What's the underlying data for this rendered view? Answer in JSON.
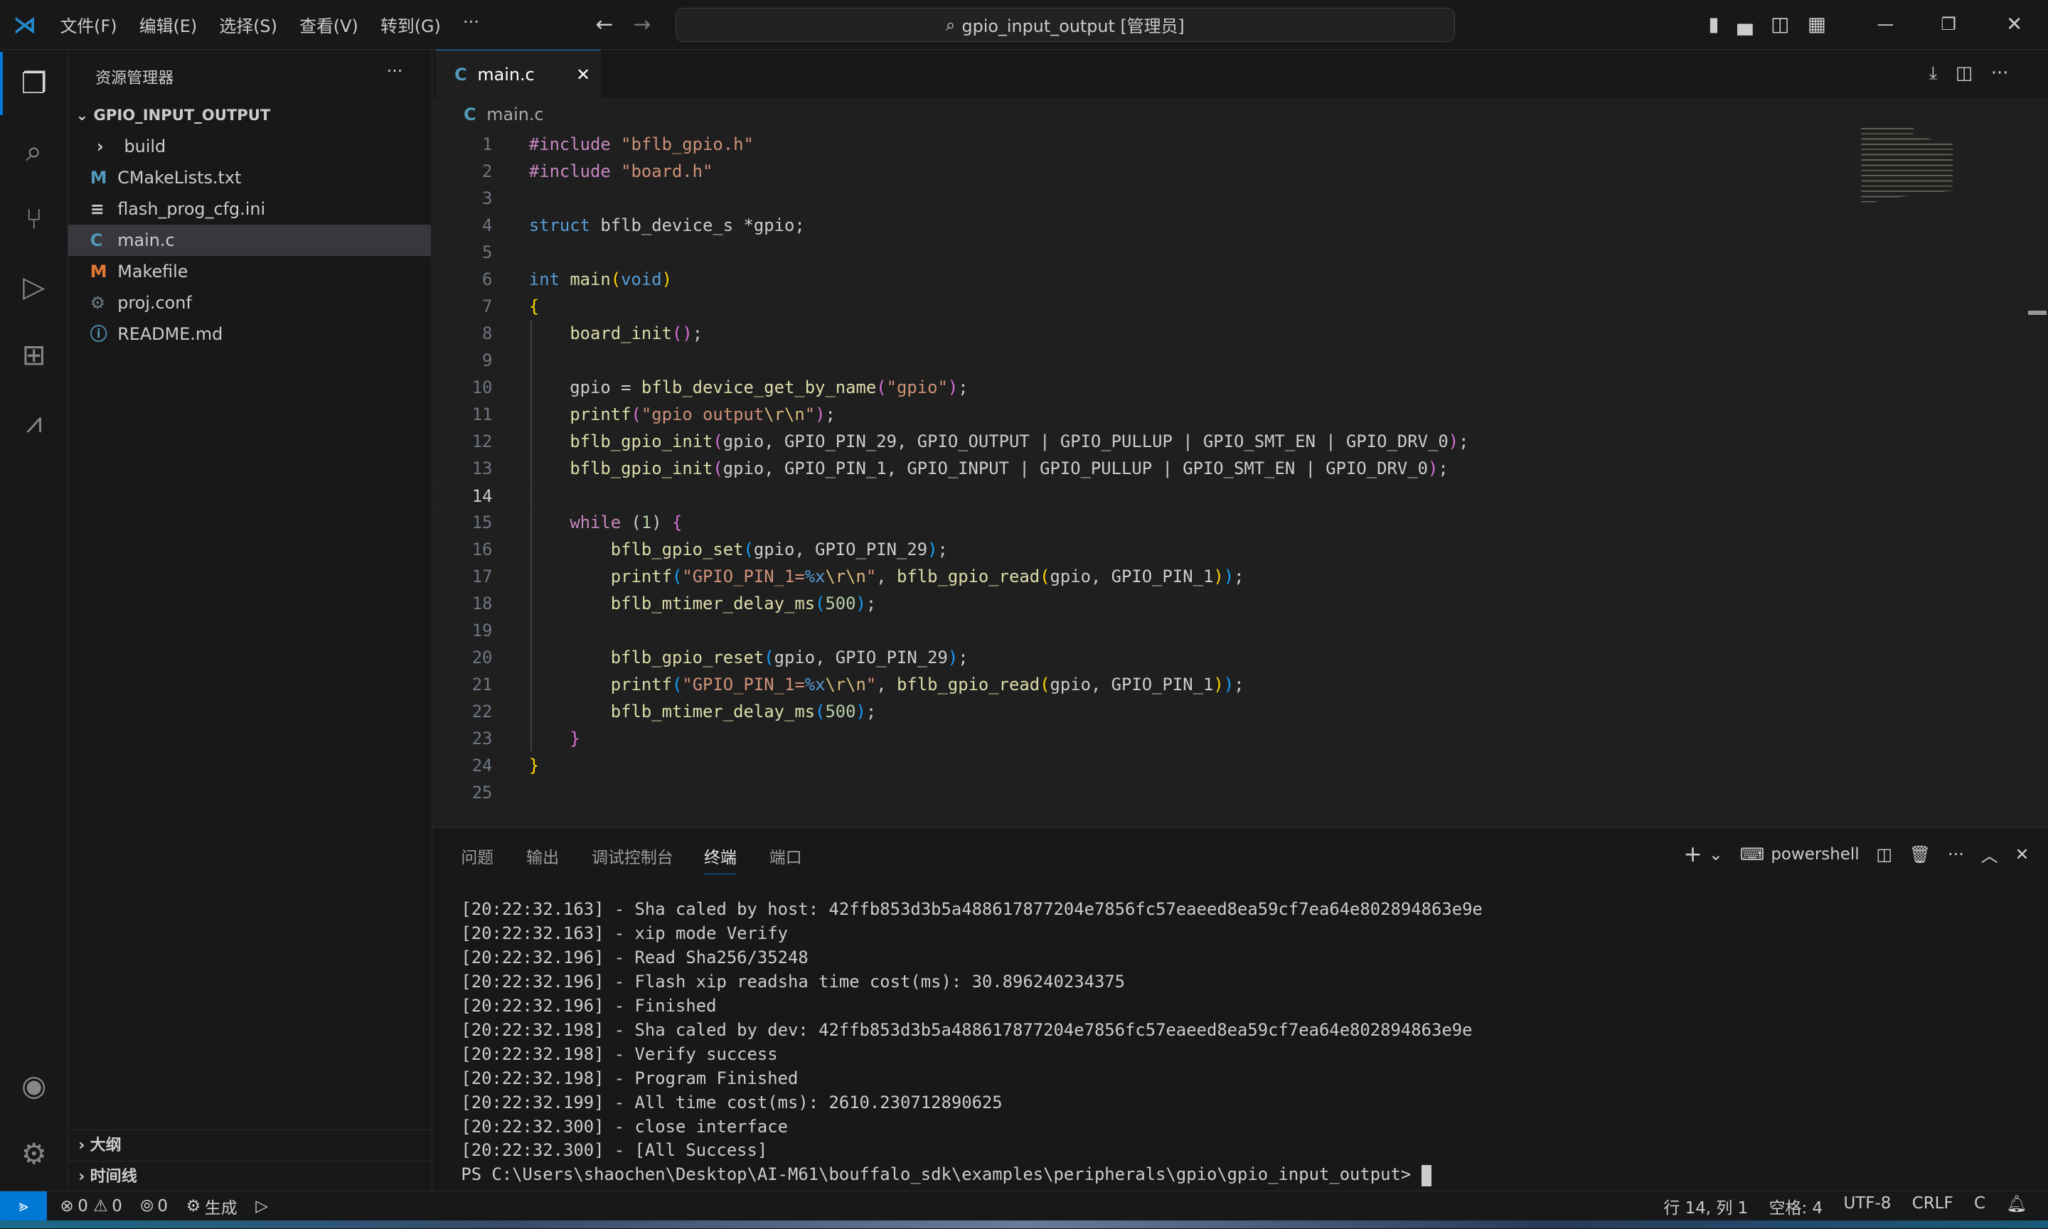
{
  "titlebar": {
    "menus": [
      "文件(F)",
      "编辑(E)",
      "选择(S)",
      "查看(V)",
      "转到(G)",
      "···"
    ],
    "search": "gpio_input_output [管理员]"
  },
  "sidebar": {
    "title": "资源管理器",
    "more": "···",
    "folder": "GPIO_INPUT_OUTPUT",
    "items": [
      {
        "label": "build",
        "icon": "chevron-right",
        "color": "#ccc"
      },
      {
        "label": "CMakeLists.txt",
        "icon": "M",
        "color": "#519aba"
      },
      {
        "label": "flash_prog_cfg.ini",
        "icon": "≡",
        "color": "#ccc"
      },
      {
        "label": "main.c",
        "icon": "C",
        "color": "#519aba",
        "selected": true
      },
      {
        "label": "Makefile",
        "icon": "M",
        "color": "#e37933"
      },
      {
        "label": "proj.conf",
        "icon": "⚙",
        "color": "#6d8086"
      },
      {
        "label": "README.md",
        "icon": "ⓘ",
        "color": "#519aba"
      }
    ],
    "outline": "大纲",
    "timeline": "时间线"
  },
  "editor": {
    "tab": "main.c",
    "breadcrumb": "main.c",
    "current_line": 14,
    "colors": {
      "kw": "#569cd6",
      "pp": "#c586c0",
      "str": "#ce9178",
      "fn": "#dcdcaa",
      "num": "#b5cea8",
      "esc": "#d7ba7d",
      "b1": "#ffd700",
      "b2": "#da70d6",
      "b3": "#179fff",
      "tx": "#cccccc",
      "ctl": "#c586c0"
    },
    "lines": [
      [
        [
          "#include ",
          "pp"
        ],
        [
          "\"bflb_gpio.h\"",
          "str"
        ]
      ],
      [
        [
          "#include ",
          "pp"
        ],
        [
          "\"board.h\"",
          "str"
        ]
      ],
      [],
      [
        [
          "struct",
          "kw"
        ],
        [
          " bflb_device_s *gpio;",
          "tx"
        ]
      ],
      [],
      [
        [
          "int",
          "kw"
        ],
        [
          " ",
          "tx"
        ],
        [
          "main",
          "fn"
        ],
        [
          "(",
          "b1"
        ],
        [
          "void",
          "kw"
        ],
        [
          ")",
          "b1"
        ]
      ],
      [
        [
          "{",
          "b1"
        ]
      ],
      [
        [
          "    ",
          "tx"
        ],
        [
          "board_init",
          "fn"
        ],
        [
          "()",
          "b2"
        ],
        [
          ";",
          "tx"
        ]
      ],
      [],
      [
        [
          "    gpio = ",
          "tx"
        ],
        [
          "bflb_device_get_by_name",
          "fn"
        ],
        [
          "(",
          "b2"
        ],
        [
          "\"gpio\"",
          "str"
        ],
        [
          ")",
          "b2"
        ],
        [
          ";",
          "tx"
        ]
      ],
      [
        [
          "    ",
          "tx"
        ],
        [
          "printf",
          "fn"
        ],
        [
          "(",
          "b2"
        ],
        [
          "\"gpio output",
          "str"
        ],
        [
          "\\r\\n",
          "esc"
        ],
        [
          "\"",
          "str"
        ],
        [
          ")",
          "b2"
        ],
        [
          ";",
          "tx"
        ]
      ],
      [
        [
          "    ",
          "tx"
        ],
        [
          "bflb_gpio_init",
          "fn"
        ],
        [
          "(",
          "b2"
        ],
        [
          "gpio, GPIO_PIN_29, GPIO_OUTPUT | GPIO_PULLUP | GPIO_SMT_EN | GPIO_DRV_0",
          "tx"
        ],
        [
          ")",
          "b2"
        ],
        [
          ";",
          "tx"
        ]
      ],
      [
        [
          "    ",
          "tx"
        ],
        [
          "bflb_gpio_init",
          "fn"
        ],
        [
          "(",
          "b2"
        ],
        [
          "gpio, GPIO_PIN_1, GPIO_INPUT | GPIO_PULLUP | GPIO_SMT_EN | GPIO_DRV_0",
          "tx"
        ],
        [
          ")",
          "b2"
        ],
        [
          ";",
          "tx"
        ]
      ],
      [],
      [
        [
          "    ",
          "tx"
        ],
        [
          "while",
          "ctl"
        ],
        [
          " (",
          "tx"
        ],
        [
          "1",
          "num"
        ],
        [
          ") ",
          "tx"
        ],
        [
          "{",
          "b2"
        ]
      ],
      [
        [
          "        ",
          "tx"
        ],
        [
          "bflb_gpio_set",
          "fn"
        ],
        [
          "(",
          "b3"
        ],
        [
          "gpio, GPIO_PIN_29",
          "tx"
        ],
        [
          ")",
          "b3"
        ],
        [
          ";",
          "tx"
        ]
      ],
      [
        [
          "        ",
          "tx"
        ],
        [
          "printf",
          "fn"
        ],
        [
          "(",
          "b3"
        ],
        [
          "\"GPIO_PIN_1=",
          "str"
        ],
        [
          "%x",
          "kw"
        ],
        [
          "\\r\\n",
          "esc"
        ],
        [
          "\"",
          "str"
        ],
        [
          ", ",
          "tx"
        ],
        [
          "bflb_gpio_read",
          "fn"
        ],
        [
          "(",
          "b1"
        ],
        [
          "gpio, GPIO_PIN_1",
          "tx"
        ],
        [
          ")",
          "b1"
        ],
        [
          ")",
          "b3"
        ],
        [
          ";",
          "tx"
        ]
      ],
      [
        [
          "        ",
          "tx"
        ],
        [
          "bflb_mtimer_delay_ms",
          "fn"
        ],
        [
          "(",
          "b3"
        ],
        [
          "500",
          "num"
        ],
        [
          ")",
          "b3"
        ],
        [
          ";",
          "tx"
        ]
      ],
      [],
      [
        [
          "        ",
          "tx"
        ],
        [
          "bflb_gpio_reset",
          "fn"
        ],
        [
          "(",
          "b3"
        ],
        [
          "gpio, GPIO_PIN_29",
          "tx"
        ],
        [
          ")",
          "b3"
        ],
        [
          ";",
          "tx"
        ]
      ],
      [
        [
          "        ",
          "tx"
        ],
        [
          "printf",
          "fn"
        ],
        [
          "(",
          "b3"
        ],
        [
          "\"GPIO_PIN_1=",
          "str"
        ],
        [
          "%x",
          "kw"
        ],
        [
          "\\r\\n",
          "esc"
        ],
        [
          "\"",
          "str"
        ],
        [
          ", ",
          "tx"
        ],
        [
          "bflb_gpio_read",
          "fn"
        ],
        [
          "(",
          "b1"
        ],
        [
          "gpio, GPIO_PIN_1",
          "tx"
        ],
        [
          ")",
          "b1"
        ],
        [
          ")",
          "b3"
        ],
        [
          ";",
          "tx"
        ]
      ],
      [
        [
          "        ",
          "tx"
        ],
        [
          "bflb_mtimer_delay_ms",
          "fn"
        ],
        [
          "(",
          "b3"
        ],
        [
          "500",
          "num"
        ],
        [
          ")",
          "b3"
        ],
        [
          ";",
          "tx"
        ]
      ],
      [
        [
          "    ",
          "tx"
        ],
        [
          "}",
          "b2"
        ]
      ],
      [
        [
          "}",
          "b1"
        ]
      ],
      []
    ]
  },
  "panel": {
    "tabs": [
      "问题",
      "输出",
      "调试控制台",
      "终端",
      "端口"
    ],
    "active_tab": "终端",
    "shell": "powershell",
    "terminal": [
      "[20:22:32.163] - Sha caled by host: 42ffb853d3b5a488617877204e7856fc57eaeed8ea59cf7ea64e802894863e9e",
      "[20:22:32.163] - xip mode Verify",
      "[20:22:32.196] - Read Sha256/35248",
      "[20:22:32.196] - Flash xip readsha time cost(ms): 30.896240234375",
      "[20:22:32.196] - Finished",
      "[20:22:32.198] - Sha caled by dev: 42ffb853d3b5a488617877204e7856fc57eaeed8ea59cf7ea64e802894863e9e",
      "[20:22:32.198] - Verify success",
      "[20:22:32.198] - Program Finished",
      "[20:22:32.199] - All time cost(ms): 2610.230712890625",
      "[20:22:32.300] - close interface",
      "[20:22:32.300] - [All Success]",
      "PS C:\\Users\\shaochen\\Desktop\\AI-M61\\bouffalo_sdk\\examples\\peripherals\\gpio\\gpio_input_output> "
    ]
  },
  "status": {
    "errors": "0",
    "warnings": "0",
    "ports": "0",
    "build": "生成",
    "position": "行 14, 列 1",
    "spaces": "空格: 4",
    "encoding": "UTF-8",
    "eol": "CRLF",
    "language": "C"
  }
}
